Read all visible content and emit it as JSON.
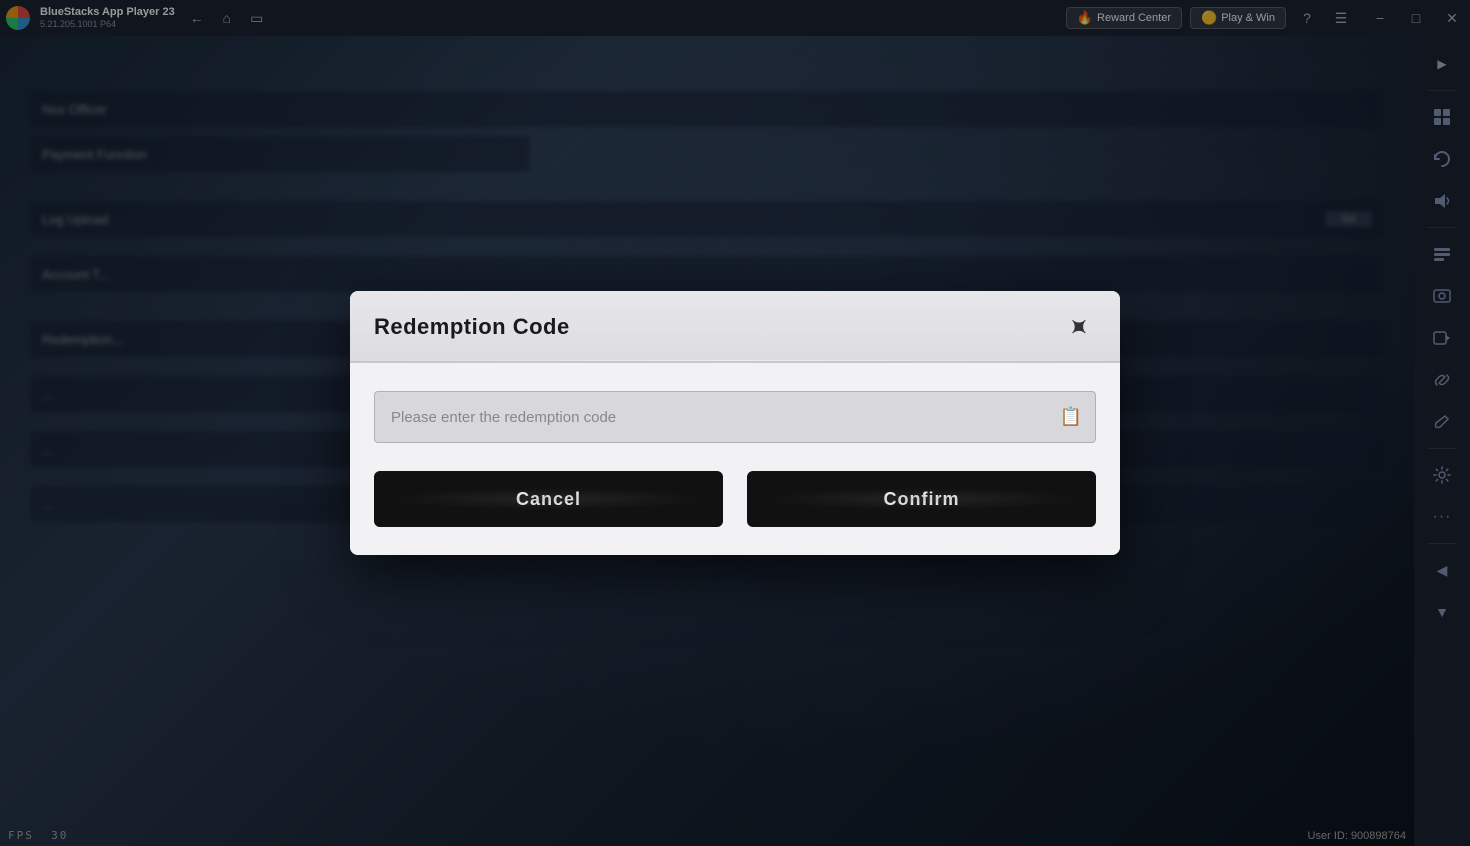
{
  "app": {
    "title": "BlueStacks App Player 23",
    "version": "5.21.205.1001 P64",
    "fps_label": "FPS",
    "fps_value": "30",
    "user_id_label": "User ID: 900898764"
  },
  "topbar": {
    "back_tooltip": "Back",
    "home_tooltip": "Home",
    "multitask_tooltip": "Multitask",
    "reward_center_label": "Reward Center",
    "play_win_label": "Play & Win",
    "help_tooltip": "Help",
    "menu_tooltip": "Menu",
    "minimize_tooltip": "Minimize",
    "maximize_tooltip": "Maximize",
    "close_tooltip": "Close"
  },
  "sidebar": {
    "icons": [
      "⬡",
      "⊞",
      "↺",
      "◎",
      "▦",
      "⊡",
      "◷",
      "⬒",
      "✦",
      "⚙",
      "⋯",
      "◀",
      "▼"
    ]
  },
  "modal": {
    "title": "Redemption Code",
    "input_placeholder": "Please enter the redemption code",
    "cancel_label": "Cancel",
    "confirm_label": "Confirm",
    "close_tooltip": "Close"
  }
}
